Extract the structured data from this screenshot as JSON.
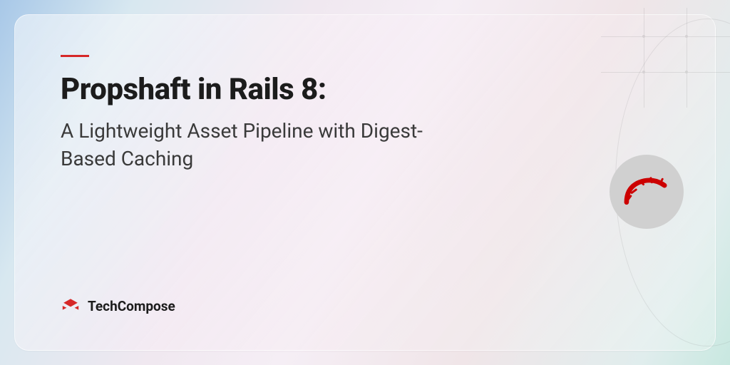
{
  "accent_color": "#d62828",
  "title": "Propshaft in Rails 8:",
  "subtitle": "A Lightweight Asset Pipeline with Digest-Based Caching",
  "brand": {
    "name": "TechCompose",
    "logo_color": "#d62828"
  },
  "badge": {
    "name": "rails-logo",
    "bg": "#d0d0d0",
    "fg": "#cc0000"
  }
}
